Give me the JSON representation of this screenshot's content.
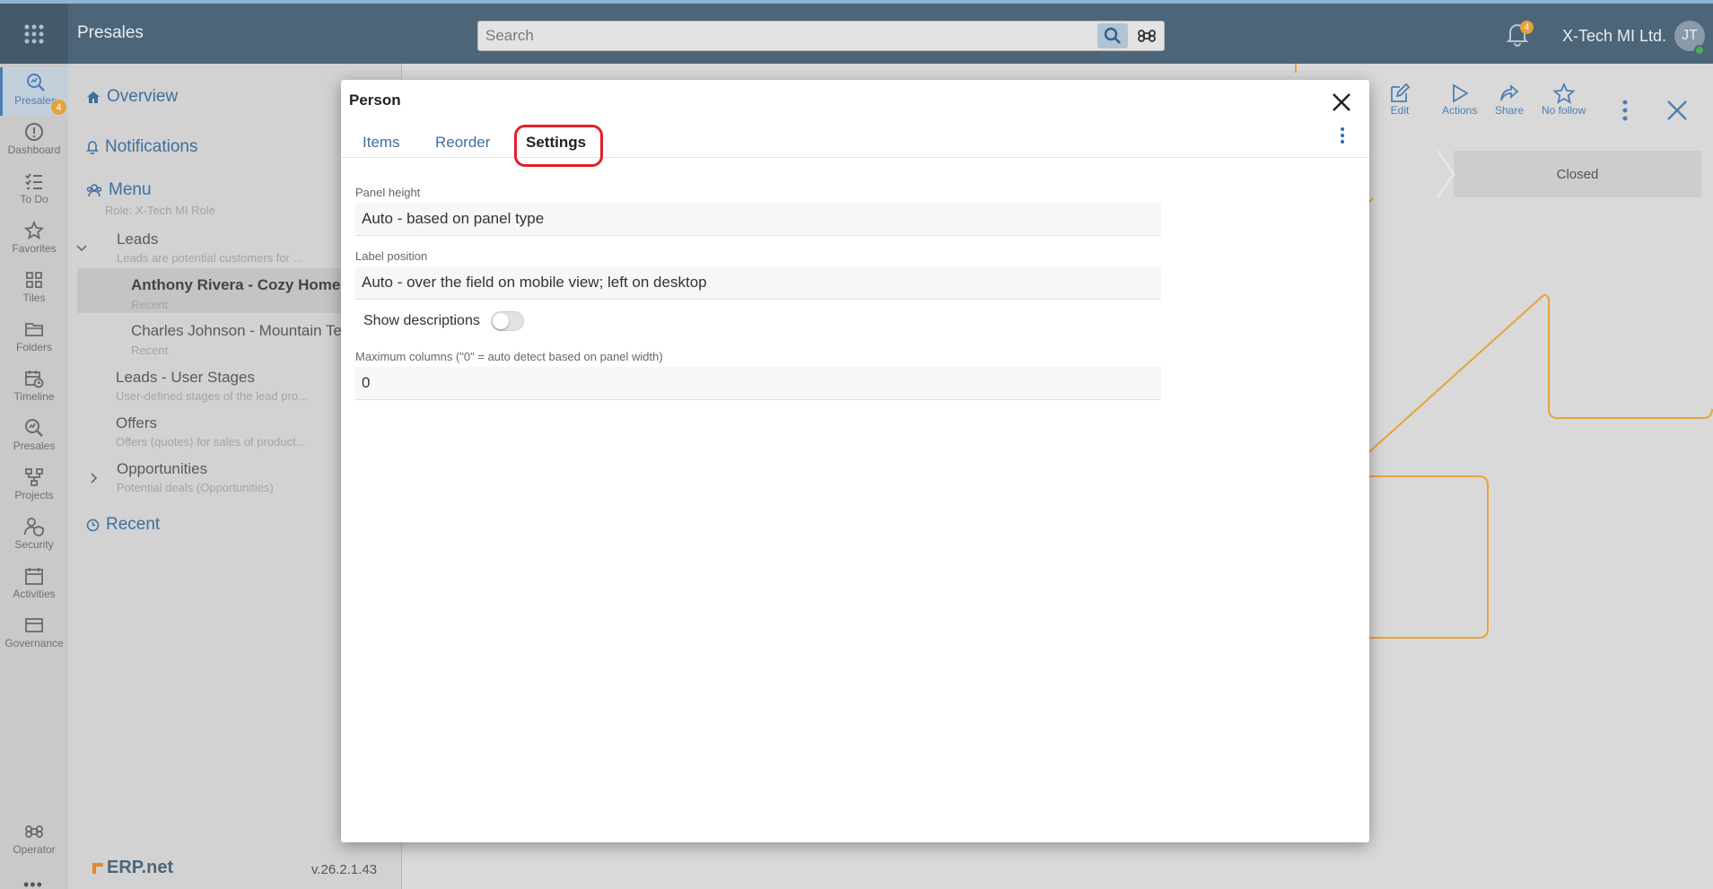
{
  "topbar": {
    "title": "Presales",
    "search_placeholder": "Search",
    "notifications_count": "4",
    "company": "X-Tech MI Ltd.",
    "user_initials": "JT"
  },
  "rail": {
    "items": [
      {
        "label": "Presales",
        "icon": "search-chart-icon"
      },
      {
        "label": "Dashboard",
        "icon": "info-icon"
      },
      {
        "label": "To Do",
        "icon": "checklist-icon"
      },
      {
        "label": "Favorites",
        "icon": "star-icon"
      },
      {
        "label": "Tiles",
        "icon": "grid-icon"
      },
      {
        "label": "Folders",
        "icon": "folder-icon"
      },
      {
        "label": "Timeline",
        "icon": "calendar-clock-icon"
      },
      {
        "label": "Presales",
        "icon": "search-chart-icon"
      },
      {
        "label": "Projects",
        "icon": "hierarchy-icon"
      },
      {
        "label": "Security",
        "icon": "user-shield-icon"
      },
      {
        "label": "Activities",
        "icon": "calendar-icon"
      },
      {
        "label": "Governance",
        "icon": "card-icon"
      }
    ],
    "todo_badge": "4",
    "operator_label": "Operator",
    "more": "•••"
  },
  "menu": {
    "overview": "Overview",
    "notifications": "Notifications",
    "menu": "Menu",
    "role": "Role: X-Tech MI Role",
    "leads": "Leads",
    "leads_desc": "Leads are potential customers for ...",
    "recent1": "Anthony Rivera - Cozy Homes",
    "recent1_sub": "Recent",
    "recent2": "Charles Johnson - Mountain Tec",
    "recent2_sub": "Recent",
    "user_stages": "Leads - User Stages",
    "user_stages_desc": "User-defined stages of the lead pro...",
    "offers": "Offers",
    "offers_desc": "Offers (quotes) for sales of product...",
    "opportunities": "Opportunities",
    "opportunities_desc": "Potential deals (Opportunities)",
    "recent": "Recent",
    "logo_text": "ERP.net",
    "version": "v.26.2.1.43"
  },
  "background": {
    "toolbar": [
      "Edit",
      "Actions",
      "Share",
      "No follow"
    ],
    "closed_stage": "Closed"
  },
  "dialog": {
    "title": "Person",
    "tabs": [
      "Items",
      "Reorder",
      "Settings"
    ],
    "active_tab": "Settings",
    "panel_height_label": "Panel height",
    "panel_height_value": "Auto - based on panel type",
    "label_position_label": "Label position",
    "label_position_value": "Auto - over the field on mobile view; left on desktop",
    "show_descriptions_label": "Show descriptions",
    "show_descriptions_on": false,
    "max_columns_label": "Maximum columns (\"0\" = auto detect based on panel width)",
    "max_columns_value": "0"
  },
  "colors": {
    "topbar": "#4d6578",
    "accent": "#3f6f9f",
    "badge": "#e3a23c",
    "highlight": "#e0202a",
    "flow_line": "#e8a33a"
  }
}
